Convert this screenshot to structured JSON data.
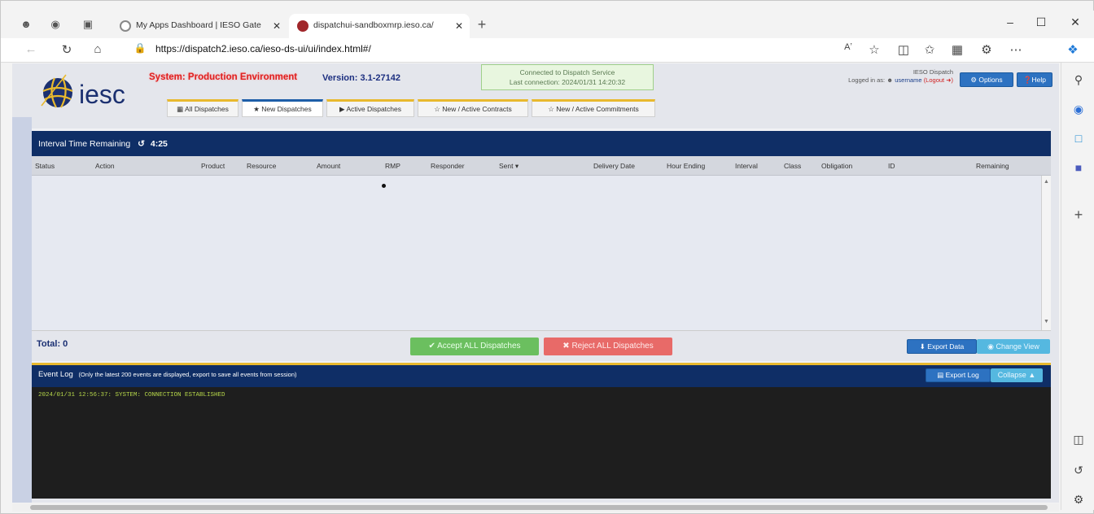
{
  "browser": {
    "tabs": [
      {
        "title": "My Apps Dashboard | IESO Gate"
      },
      {
        "title": "dispatchui-sandboxmrp.ieso.ca/"
      }
    ],
    "url": "https://dispatch2.ieso.ca/ieso-ds-ui/ui/index.html#/",
    "read_aloud": "Aʼ"
  },
  "header": {
    "logo_text": "iesc",
    "system": "System: Production Environment",
    "version": "Version: 3.1-27142",
    "connection": {
      "line1": "Connected to Dispatch Service",
      "line2": "Last connection: 2024/01/31 14:20:32"
    },
    "user": {
      "org": "IESO Dispatch",
      "logged_in_prefix": "Logged in as:",
      "username": "username",
      "logout": "(Logout"
    },
    "options_label": "Options",
    "help_label": "Help"
  },
  "tabs": [
    {
      "label": "All Dispatches",
      "icon": "grid-icon"
    },
    {
      "label": "New Dispatches",
      "icon": "star-icon"
    },
    {
      "label": "Active Dispatches",
      "icon": "play-icon"
    },
    {
      "label": "New / Active Contracts",
      "icon": "star-outline-icon"
    },
    {
      "label": "New / Active Commitments",
      "icon": "star-outline-icon"
    }
  ],
  "dispatch": {
    "interval_label": "Interval Time Remaining",
    "time": "4:25",
    "columns": [
      "Status",
      "Action",
      "Product",
      "Resource",
      "Amount",
      "RMP",
      "Responder",
      "Sent ▾",
      "Delivery Date",
      "Hour Ending",
      "Interval",
      "Class",
      "Obligation",
      "ID",
      "Remaining"
    ],
    "total": "Total: 0",
    "accept_label": "Accept ALL Dispatches",
    "reject_label": "Reject ALL Dispatches",
    "export_label": "Export Data",
    "change_view_label": "Change View"
  },
  "event_log": {
    "title": "Event Log",
    "note": "(Only the latest 200 events are displayed, export to save all events from session)",
    "export_label": "Export Log",
    "collapse_label": "Collapse",
    "lines": [
      "2024/01/31 12:56:37: SYSTEM: CONNECTION ESTABLISHED"
    ]
  },
  "colors": {
    "navy": "#0f2e66",
    "accent_gold": "#e8b92e",
    "accept_green": "#6bbf5f",
    "reject_red": "#e86a68",
    "button_blue": "#2d72c1"
  }
}
